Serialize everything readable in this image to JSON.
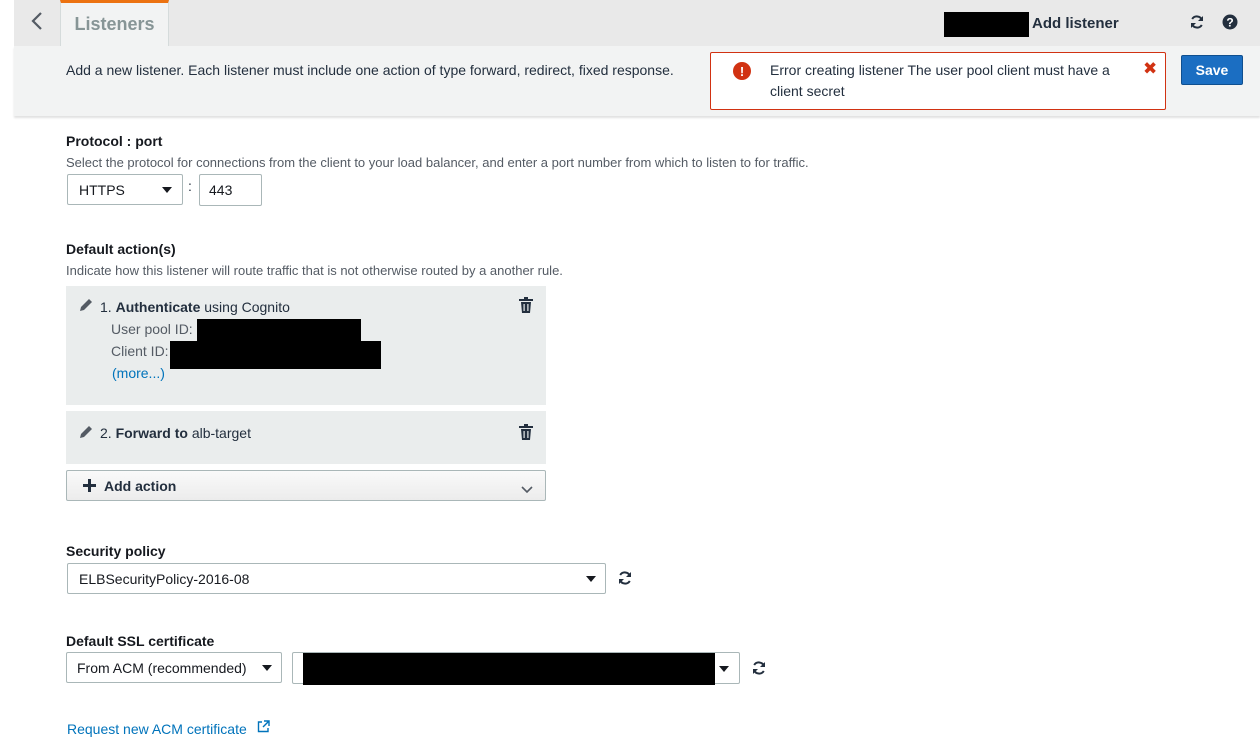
{
  "header": {
    "tab_label": "Listeners",
    "breadcrumb": "Add listener",
    "icons": {
      "back": "chevron-left-icon",
      "refresh": "refresh-icon",
      "help": "help-icon"
    }
  },
  "infobar": {
    "description": "Add a new listener. Each listener must include one action of type forward, redirect, fixed response.",
    "error": {
      "message": "Error creating listener The user pool client must have a client secret",
      "color": "#d13212"
    },
    "save_label": "Save"
  },
  "protocol": {
    "title": "Protocol : port",
    "description": "Select the protocol for connections from the client to your load balancer, and enter a port number from which to listen to for traffic.",
    "protocol_value": "HTTPS",
    "separator": ":",
    "port_value": "443"
  },
  "default_actions": {
    "title": "Default action(s)",
    "description": "Indicate how this listener will route traffic that is not otherwise routed by a another rule.",
    "actions": [
      {
        "index": "1.",
        "verb": "Authenticate",
        "rest": "using Cognito",
        "user_pool_label": "User pool ID:",
        "client_id_label": "Client ID:",
        "more_link": "(more...)"
      },
      {
        "index": "2.",
        "verb": "Forward to",
        "rest": "alb-target"
      }
    ],
    "add_action_label": "Add action"
  },
  "security_policy": {
    "title": "Security policy",
    "value": "ELBSecurityPolicy-2016-08"
  },
  "ssl_certificate": {
    "title": "Default SSL certificate",
    "source_value": "From ACM (recommended)",
    "request_link": "Request new ACM certificate"
  },
  "colors": {
    "accent_tab": "#ec7211",
    "primary_button": "#1b6ec2",
    "link": "#0073bb",
    "error": "#d13212"
  }
}
